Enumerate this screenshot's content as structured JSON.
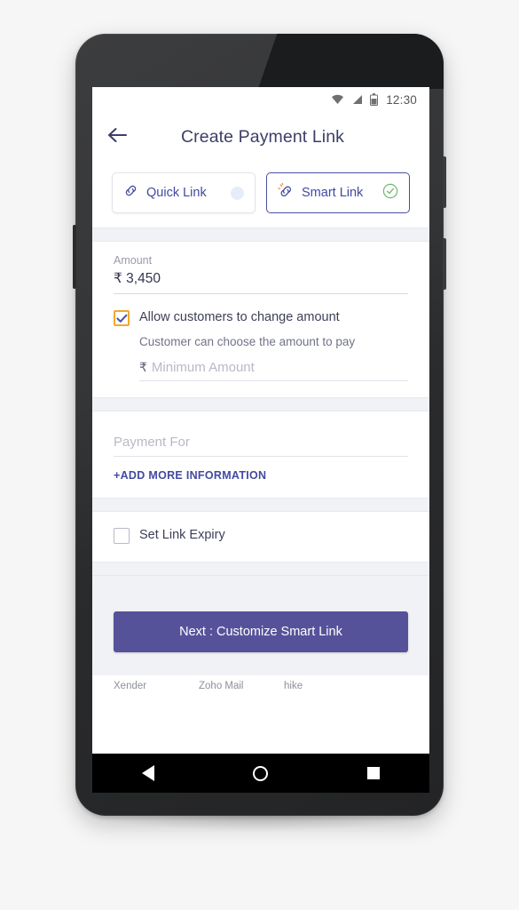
{
  "status_bar": {
    "time": "12:30",
    "icons": [
      "wifi-icon",
      "signal-icon",
      "battery-icon"
    ]
  },
  "app_bar": {
    "back_icon": "arrow-left-icon",
    "title": "Create Payment Link"
  },
  "tabs": [
    {
      "id": "quick-link",
      "label": "Quick Link",
      "icon": "chain-link-icon",
      "selected": false,
      "indicator": "empty-circle"
    },
    {
      "id": "smart-link",
      "label": "Smart Link",
      "icon": "smart-chain-link-icon",
      "selected": true,
      "indicator": "green-check-circle"
    }
  ],
  "amount_section": {
    "label": "Amount",
    "value": "₹ 3,450",
    "allow_change": {
      "label": "Allow customers to change amount",
      "checked": true,
      "sub_label": "Customer can choose the amount to pay"
    },
    "minimum_amount": {
      "currency_symbol": "₹",
      "placeholder": "Minimum Amount",
      "value": ""
    }
  },
  "payment_for_section": {
    "placeholder": "Payment For",
    "value": "",
    "add_more_label": "+ADD MORE INFORMATION"
  },
  "expiry_section": {
    "label": "Set Link Expiry",
    "checked": false
  },
  "cta": {
    "label": "Next : Customize Smart Link"
  },
  "home_peek": {
    "apps": [
      "Xender",
      "Zoho Mail",
      "hike"
    ]
  },
  "nav_bar": {
    "back": "nav-back-triangle",
    "home": "nav-home-circle",
    "recents": "nav-recents-square"
  },
  "colors": {
    "brand_purple": "#4349a0",
    "cta_purple": "#56529a",
    "accent_orange": "#f2a92b",
    "success_green": "#6cb86c",
    "title_text": "#3c3e67"
  }
}
